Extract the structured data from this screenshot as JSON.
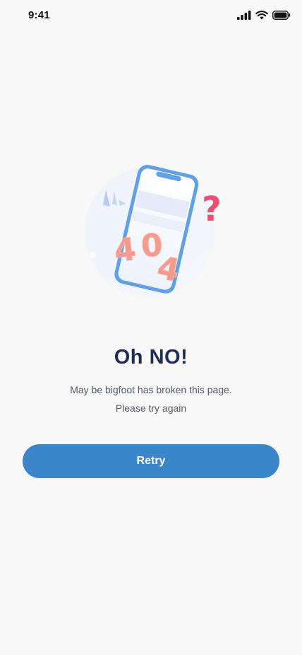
{
  "status_bar": {
    "time": "9:41",
    "icons": [
      "signal-icon",
      "wifi-icon",
      "battery-icon"
    ]
  },
  "illustration": {
    "icon": "broken-phone-404-illustration",
    "code_digits": [
      "4",
      "0",
      "4"
    ],
    "question_mark": "?"
  },
  "error": {
    "title": "Oh NO!",
    "message_line1": "May be bigfoot has broken this page.",
    "message_line2": "Please try again"
  },
  "actions": {
    "retry_label": "Retry"
  },
  "colors": {
    "background": "#f8f8f8",
    "title": "#1f2d57",
    "body_text": "#555a66",
    "primary_button": "#3b85cb",
    "phone_outline": "#5fa0e6",
    "digits": "#f59a8c",
    "question_mark": "#ef4f6e"
  }
}
